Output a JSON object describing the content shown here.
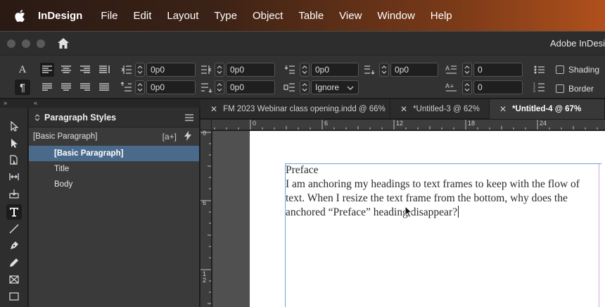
{
  "menubar": {
    "app_name": "InDesign",
    "items": [
      "File",
      "Edit",
      "Layout",
      "Type",
      "Object",
      "Table",
      "View",
      "Window",
      "Help"
    ]
  },
  "window": {
    "title": "Adobe InDesi"
  },
  "control_panel": {
    "left_indent": "0p0",
    "first_line_indent": "0p0",
    "right_indent": "0p0",
    "last_line_indent": "0p0",
    "space_before": "0p0",
    "space_after": "0p0",
    "align_to_grid": "Ignore",
    "drop_cap_lines": "0",
    "drop_cap_chars": "0",
    "shading_label": "Shading",
    "border_label": "Border"
  },
  "tabs": [
    {
      "label": "FM 2023 Webinar class opening.indd @ 66%",
      "active": false
    },
    {
      "label": "*Untitled-3 @ 62%",
      "active": false
    },
    {
      "label": "*Untitled-4 @ 67%",
      "active": true
    }
  ],
  "panel": {
    "title": "Paragraph Styles",
    "current_style": "[Basic Paragraph]",
    "new_from_local_label": "[a+]",
    "styles": [
      {
        "name": "[Basic Paragraph]",
        "selected": true
      },
      {
        "name": "Title",
        "selected": false
      },
      {
        "name": "Body",
        "selected": false
      }
    ]
  },
  "rulers": {
    "horizontal": [
      "0",
      "6",
      "12",
      "18",
      "24"
    ],
    "vertical": [
      "0",
      "6",
      "1",
      "2"
    ]
  },
  "document": {
    "heading": "Preface",
    "body": "I am anchoring my headings to text frames to keep with the flow of text.  When I resize the text frame from the bottom, why does the anchored “Preface” heading disappear?"
  },
  "colors": {
    "selection": "#4a6a8c",
    "frame_edge": "#6fa3d8",
    "menubar_accent": "#b0501c"
  }
}
